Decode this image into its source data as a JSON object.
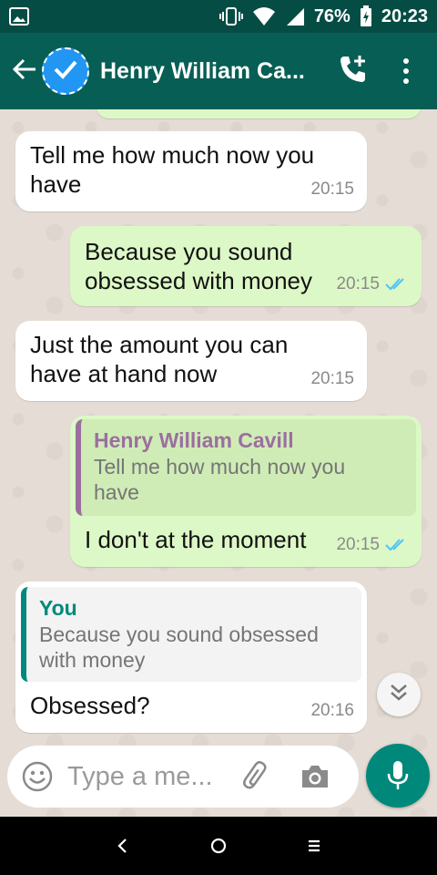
{
  "status_bar": {
    "battery": "76%",
    "time": "20:23"
  },
  "header": {
    "contact_name": "Henry William Ca..."
  },
  "messages": [
    {
      "direction": "in",
      "text_line1": "Tell me how much now you",
      "text_line2": "have",
      "time": "20:15"
    },
    {
      "direction": "out",
      "text_line1": "Because you sound",
      "text_line2": "obsessed with money",
      "time": "20:15",
      "read": true
    },
    {
      "direction": "in",
      "text_line1": "Just the amount you can",
      "text_line2": "have at hand now",
      "time": "20:15"
    },
    {
      "direction": "out",
      "quote_name": "Henry William Cavill",
      "quote_line1": "Tell me how much now you",
      "quote_line2": "have",
      "text": "I don't at the moment",
      "time": "20:15",
      "read": true
    },
    {
      "direction": "in",
      "quote_name": "You",
      "quote_line1": "Because you sound obsessed",
      "quote_line2": "with money",
      "text": "Obsessed?",
      "time": "20:16"
    }
  ],
  "composer": {
    "placeholder": "Type a me..."
  },
  "colors": {
    "header": "#075e54",
    "status": "#054d44",
    "outgoing": "#dcf8c6",
    "incoming": "#ffffff",
    "accent": "#00897b",
    "read_ticks": "#4fc3f7"
  }
}
